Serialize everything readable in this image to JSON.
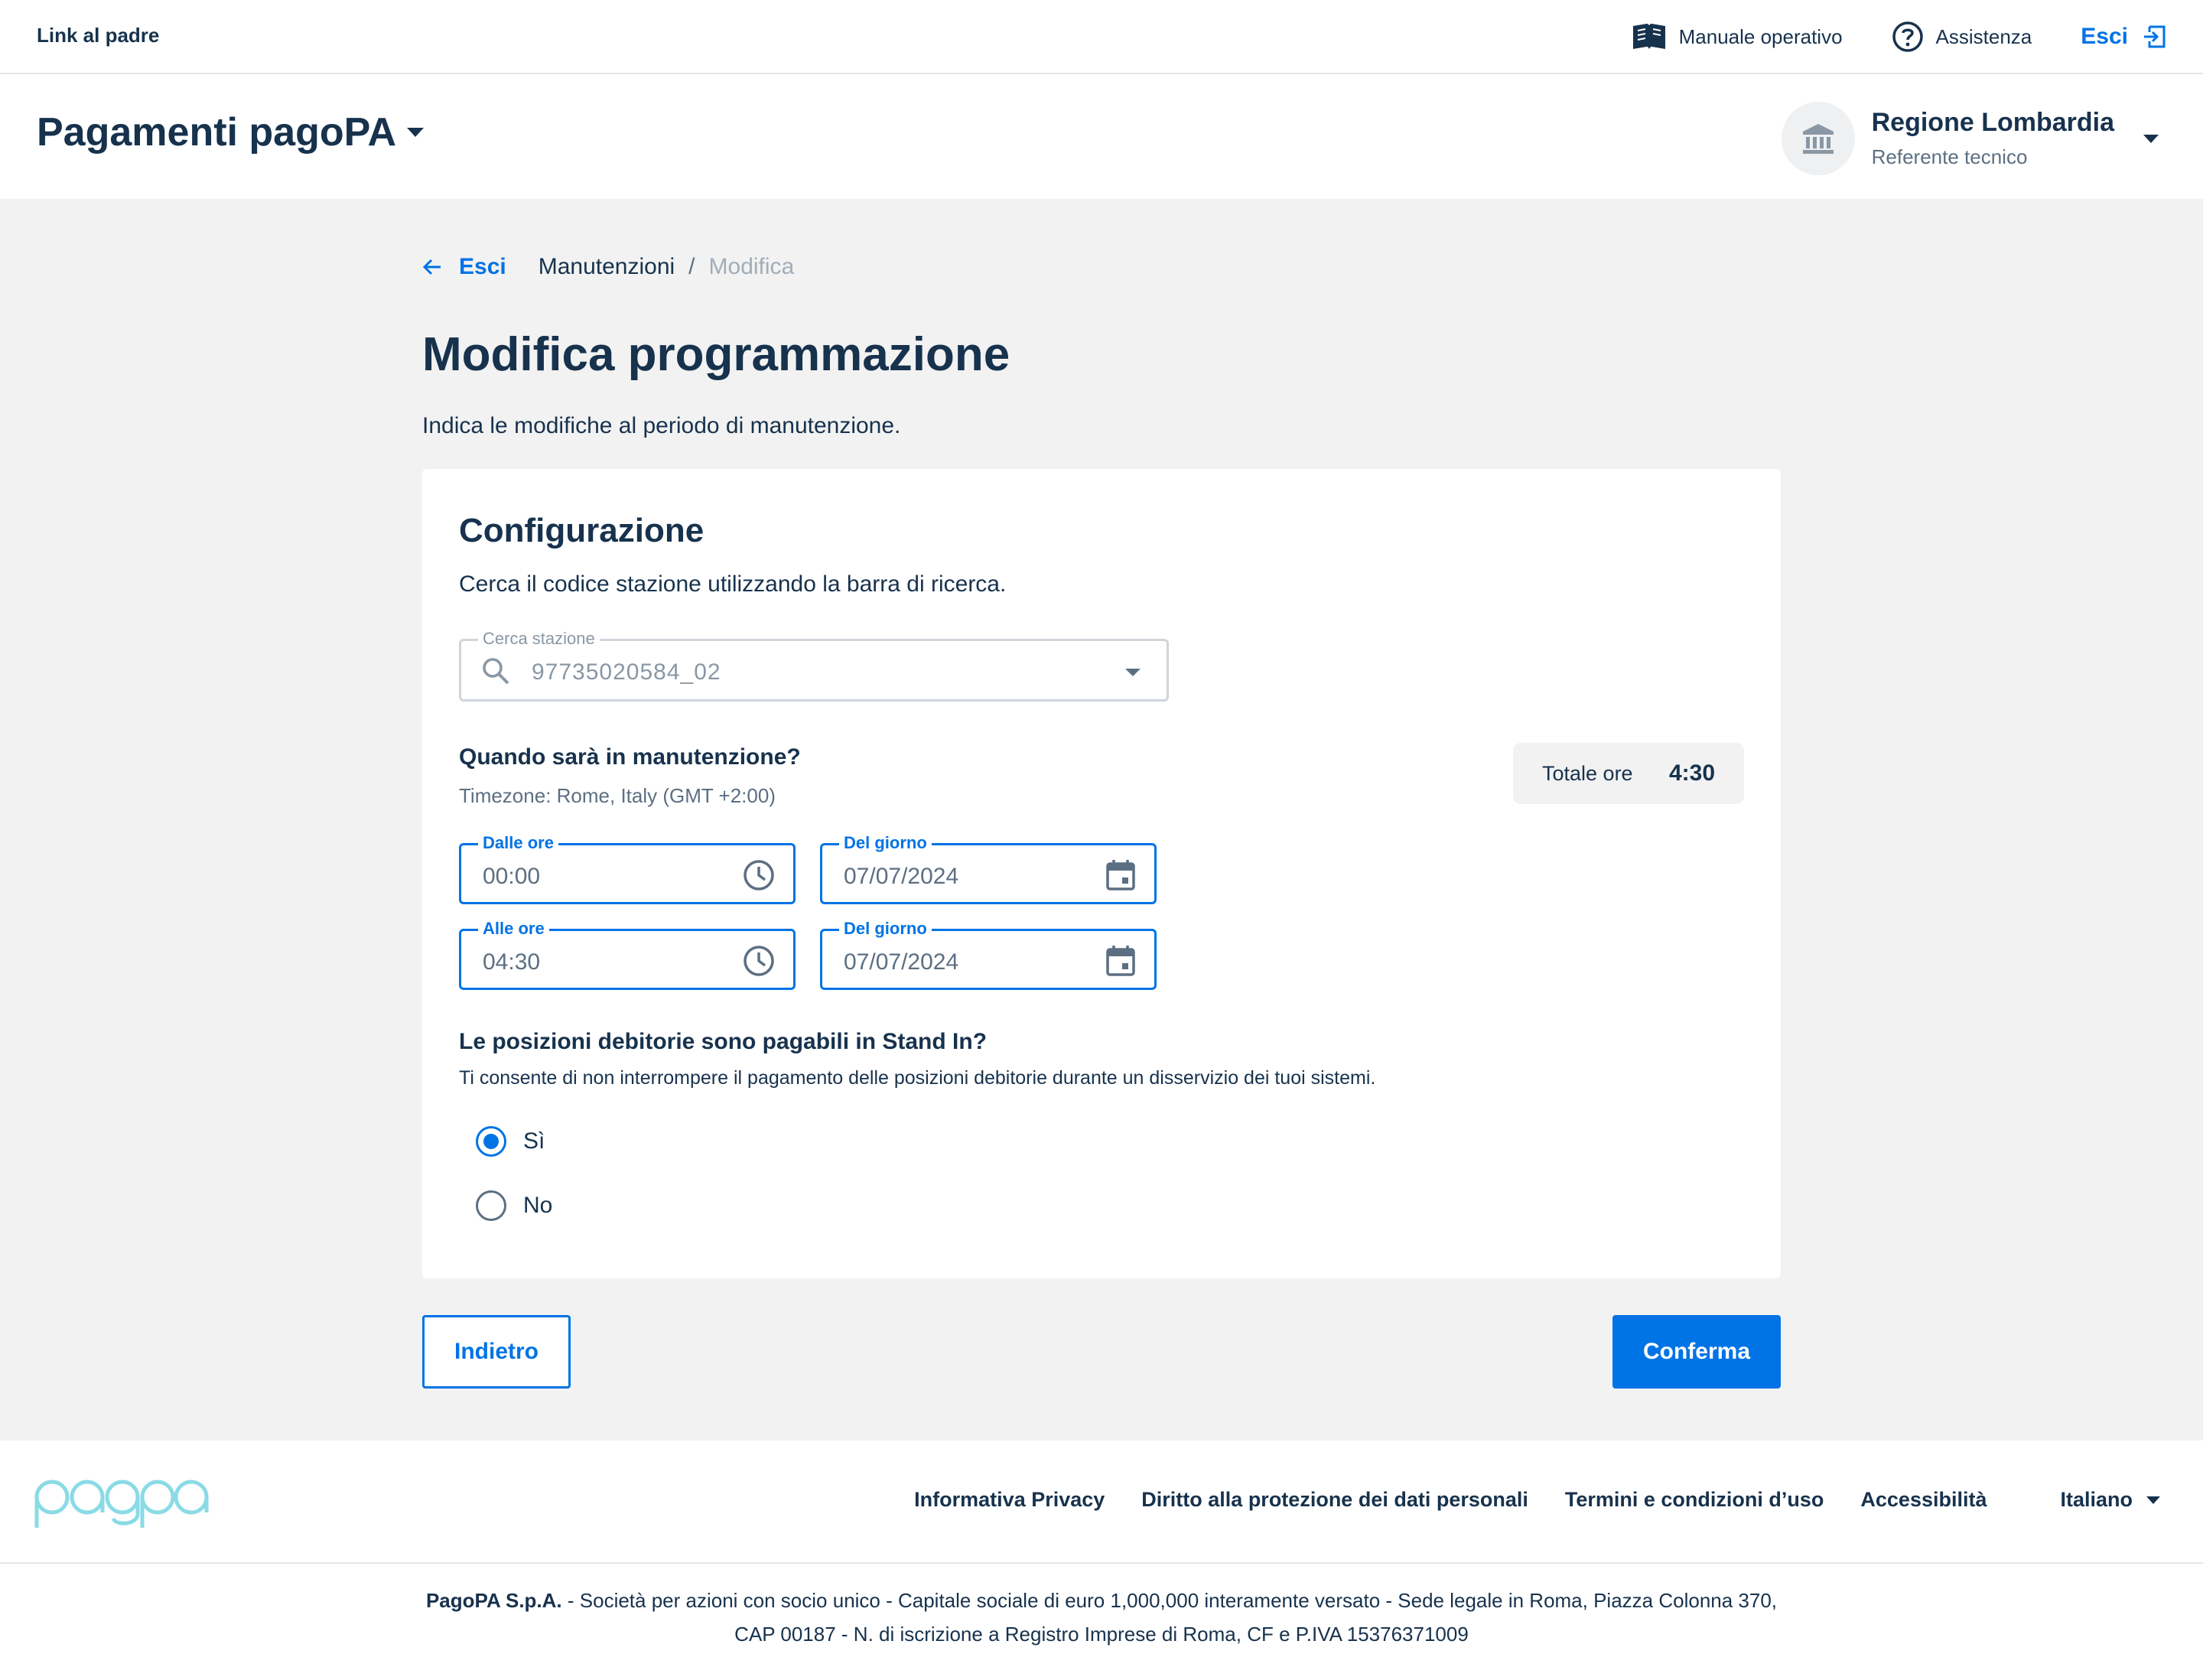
{
  "topbar": {
    "parent_link": "Link al padre",
    "manual": "Manuale operativo",
    "help": "Assistenza",
    "exit": "Esci"
  },
  "header": {
    "product": "Pagamenti pagoPA",
    "party_name": "Regione Lombardia",
    "party_role": "Referente tecnico"
  },
  "breadcrumb": {
    "back": "Esci",
    "items": [
      "Manutenzioni",
      "Modifica"
    ],
    "separator": "/"
  },
  "page": {
    "title": "Modifica programmazione",
    "subtitle": "Indica le modifiche al periodo di manutenzione."
  },
  "config": {
    "title": "Configurazione",
    "description": "Cerca il codice stazione utilizzando la barra di ricerca.",
    "search_label": "Cerca stazione",
    "search_value": "97735020584_02"
  },
  "schedule": {
    "question": "Quando sarà in manutenzione?",
    "timezone": "Timezone: Rome, Italy (GMT +2:00)",
    "total_label": "Totale ore",
    "total_value": "4:30",
    "from_time_label": "Dalle ore",
    "from_time": "00:00",
    "from_date_label": "Del giorno",
    "from_date": "07/07/2024",
    "to_time_label": "Alle ore",
    "to_time": "04:30",
    "to_date_label": "Del giorno",
    "to_date": "07/07/2024"
  },
  "standin": {
    "question": "Le posizioni debitorie sono pagabili in Stand In?",
    "description": "Ti consente di non interrompere il pagamento delle posizioni debitorie durante un disservizio dei tuoi sistemi.",
    "options": [
      {
        "label": "Sì",
        "selected": true
      },
      {
        "label": "No",
        "selected": false
      }
    ]
  },
  "actions": {
    "back": "Indietro",
    "confirm": "Conferma"
  },
  "footer": {
    "logo_text": "pagopa",
    "links": [
      "Informativa Privacy",
      "Diritto alla protezione dei dati personali",
      "Termini e condizioni d’uso",
      "Accessibilità"
    ],
    "language": "Italiano",
    "company": "PagoPA S.p.A.",
    "legal_line1": " - Società per azioni con socio unico - Capitale sociale di euro 1,000,000 interamente versato - Sede legale in Roma, Piazza Colonna 370,",
    "legal_line2": "CAP 00187 - N. di iscrizione a Registro Imprese di Roma, CF e P.IVA 15376371009"
  },
  "colors": {
    "primary": "#0073e6",
    "text": "#17324d",
    "muted": "#5c6f82",
    "background": "#f2f2f2",
    "logo": "#8adbe6"
  }
}
